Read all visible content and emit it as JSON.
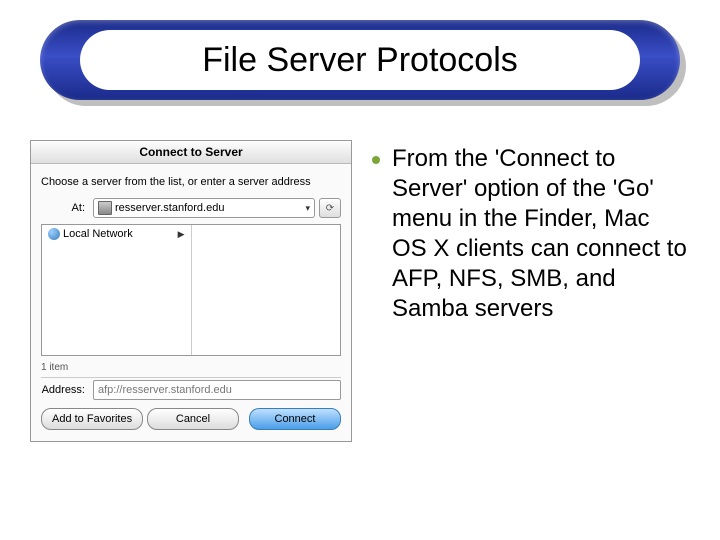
{
  "title": "File Server Protocols",
  "bullet": "From the 'Connect to Server' option of the 'Go' menu in the Finder, Mac OS X clients can connect to AFP, NFS, SMB, and Samba servers",
  "dialog": {
    "title": "Connect to Server",
    "instruction": "Choose a server from the list, or enter a server address",
    "at_label": "At:",
    "at_value": "resserver.stanford.edu",
    "browser_item": "Local Network",
    "status": "1 item",
    "addr_label": "Address:",
    "addr_value": "afp://resserver.stanford.edu",
    "btn_favorites": "Add to Favorites",
    "btn_cancel": "Cancel",
    "btn_connect": "Connect"
  }
}
